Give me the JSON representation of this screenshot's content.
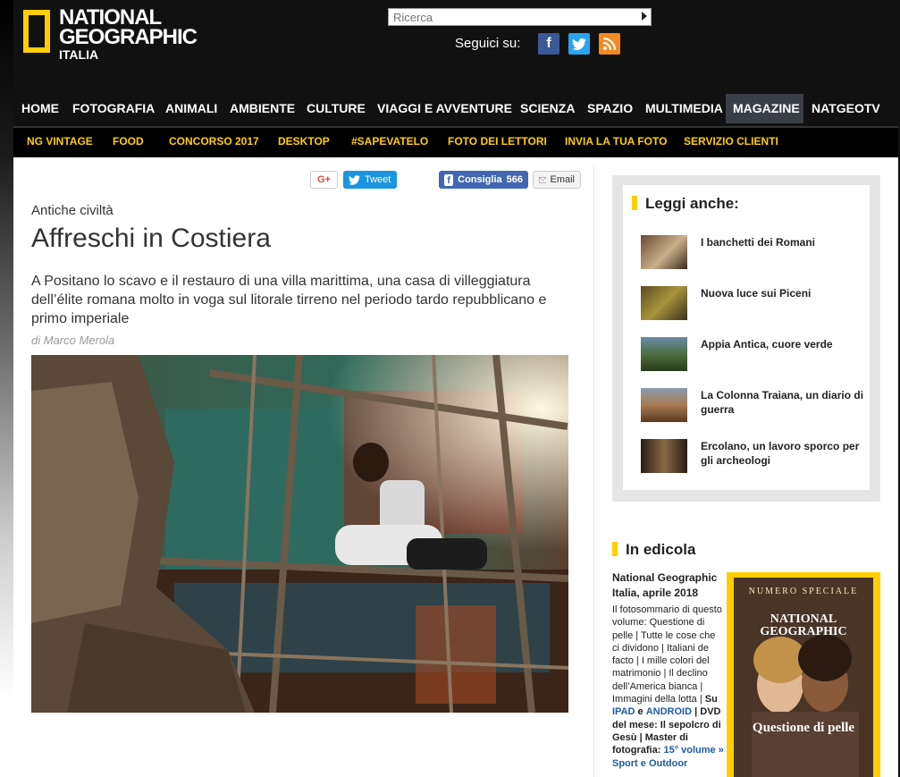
{
  "brand": {
    "line1": "NATIONAL",
    "line2": "GEOGRAPHIC",
    "line3": "ITALIA",
    "accent": "#ffce00"
  },
  "search": {
    "placeholder": "Ricerca"
  },
  "social": {
    "label": "Seguici su:",
    "icons": [
      "facebook-icon",
      "twitter-icon",
      "rss-icon"
    ]
  },
  "nav": {
    "items": [
      "HOME",
      "FOTOGRAFIA",
      "ANIMALI",
      "AMBIENTE",
      "CULTURE",
      "VIAGGI E AVVENTURE",
      "SCIENZA",
      "SPAZIO",
      "MULTIMEDIA",
      "MAGAZINE",
      "NATGEOTV"
    ],
    "active": "MAGAZINE"
  },
  "subnav": {
    "items": [
      "NG VINTAGE",
      "FOOD",
      "CONCORSO 2017",
      "DESKTOP",
      "#SAPEVATELO",
      "FOTO DEI LETTORI",
      "INVIA LA TUA FOTO",
      "SERVIZIO CLIENTI"
    ]
  },
  "share": {
    "gplus": "G+",
    "tweet": "Tweet",
    "consiglia": "Consiglia",
    "count": "566",
    "email": "Email"
  },
  "article": {
    "category": "Antiche civiltà",
    "title": "Affreschi in Costiera",
    "lead": "A Positano lo scavo e il restauro di una villa marittima, una casa di villeggiatura dell’élite romana molto in voga sul litorale tirreno nel periodo tardo repubblicano e primo imperiale",
    "byline": "di Marco Merola"
  },
  "sidebar": {
    "readmore_title": "Leggi anche:",
    "readmore": [
      {
        "title": "I banchetti dei Romani"
      },
      {
        "title": "Nuova luce sui Piceni"
      },
      {
        "title": "Appia Antica, cuore verde"
      },
      {
        "title": "La Colonna Traiana, un diario di guerra"
      },
      {
        "title": "Ercolano, un lavoro sporco per gli archeologi"
      }
    ],
    "edicola_title": "In edicola",
    "edicola_name": "National Geographic Italia, aprile 2018",
    "edicola": {
      "d1": "Il fotosommario di questo volume: Questione di pelle | Tutte le cose che ci dividono | Italiani de facto | I mille colori del matrimonio | Il declino dell’America bianca | Immagini della lotta |",
      "d2": "Su",
      "d3": "IPAD",
      "d4": "e",
      "d5": "ANDROID",
      "d6": "| DVD del mese: Il sepolcro di Gesù | Master di fotografia:",
      "d7": "15° volume » Sport e Outdoor"
    },
    "cover": {
      "special": "NUMERO SPECIALE",
      "ng": "NATIONAL GEOGRAPHIC",
      "headline": "Questione di pelle"
    }
  }
}
